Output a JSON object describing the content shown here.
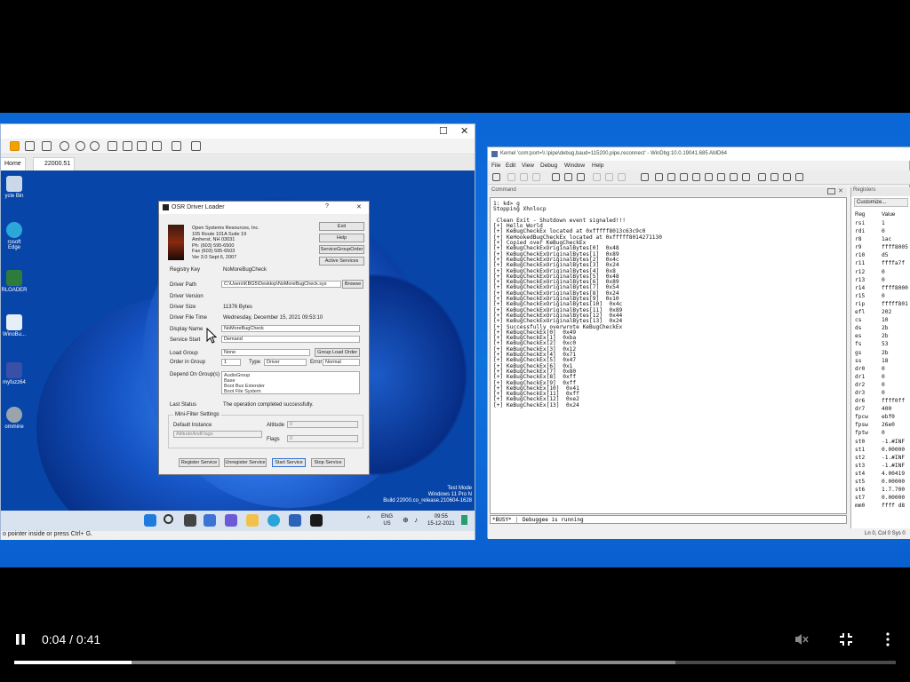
{
  "player": {
    "time": "0:04 / 0:41",
    "progress_fraction": 0.133,
    "buffered_fraction": 0.75
  },
  "vm": {
    "tab_home": "Home",
    "tab_machine": "22000.51",
    "status": "o pointer inside or press Ctrl+ G.",
    "desktop_icons": [
      "ycle Bin",
      "rosoft Edge",
      "RLOADER",
      "WinoBu...",
      "myfuzz64",
      "ommine"
    ],
    "watermark": [
      "Test Mode",
      "Windows 11 Pro N",
      "Build 22000.co_release.210604-1628"
    ],
    "tray": {
      "lang": "ENG",
      "region": "US",
      "time": "09:55",
      "date": "15-12-2021"
    }
  },
  "osr": {
    "title": "OSR Driver Loader",
    "company": [
      "Open Systems Resources, Inc.",
      "105 Route 101A Suite 19",
      "Amherst, NH 03031",
      "Ph: (603) 595-6500",
      "Fax (603) 595-6503",
      "Ver 3.0    Sept 6, 2007"
    ],
    "exit": "Exit",
    "help": "Help",
    "service_group": "ServiceGroupOrder",
    "active_services": "Active Services",
    "registry_key_label": "Registry Key",
    "registry_key": "NoMoreBugCheck",
    "driver_path_label": "Driver Path",
    "driver_path": "C:\\Users\\KBG5\\Desktop\\NoMoreBugCheck.sys",
    "browse": "Browse",
    "driver_version_label": "Driver Version",
    "driver_size_label": "Driver Size",
    "driver_size": "11376 Bytes",
    "driver_time_label": "Driver File Time",
    "driver_time": "Wednesday, December 15, 2021 09:53:10",
    "display_name_label": "Display Name",
    "display_name": "NoMoreBugCheck",
    "service_start_label": "Service Start",
    "service_start": "Demand",
    "load_group_label": "Load Group",
    "load_group": "None",
    "group_load_order": "Group Load Order",
    "order_group_label": "Order in Group",
    "order_group": "1",
    "type_label": "Type",
    "type_value": "Driver",
    "error_label": "Error",
    "error_value": "Normal",
    "depend_label": "Depend On Group(s)",
    "depend_items": [
      "AudioGroup",
      "Base",
      "Boot Bus Extender",
      "Boot File System"
    ],
    "last_status_label": "Last Status",
    "last_status": "The operation completed successfully.",
    "minifilter_label": "Mini-Filter Settings",
    "default_instance_label": "Default Instance",
    "default_instance": "AltitudeAndFlags",
    "altitude_label": "Altitude",
    "altitude": "0",
    "flags_label": "Flags",
    "flags": "0",
    "register": "Register Service",
    "unregister": "Unregister Service",
    "start": "Start Service",
    "stop": "Stop Service"
  },
  "windbg": {
    "title": "Kernel 'com:port=\\\\.\\pipe\\debug,baud=115200,pipe,reconnect' - WinDbg:10.0.19041.685 AMD64",
    "menu": [
      "File",
      "Edit",
      "View",
      "Debug",
      "Window",
      "Help"
    ],
    "command_header": "Command",
    "output": [
      "1: kd> g",
      "Stopping Xhnlocp",
      "",
      " Clean Exit - Shutdown event signaled!!!",
      "[+] Hello World",
      "[+] KeBugCheckEx located at 0xfffff8013c63c9c0",
      "[+] KeHookedBugCheckEx located at 0xfffff8014271130",
      "[+] Copied over KeBugCheckEx",
      "[+] KeBugCheckExOriginalBytes[0]  0x48",
      "[+] KeBugCheckExOriginalBytes[1]  0x89",
      "[+] KeBugCheckExOriginalBytes[2]  0x4c",
      "[+] KeBugCheckExOriginalBytes[3]  0x24",
      "[+] KeBugCheckExOriginalBytes[4]  0x8",
      "[+] KeBugCheckExOriginalBytes[5]  0x48",
      "[+] KeBugCheckExOriginalBytes[6]  0x89",
      "[+] KeBugCheckExOriginalBytes[7]  0x54",
      "[+] KeBugCheckExOriginalBytes[8]  0x24",
      "[+] KeBugCheckExOriginalBytes[9]  0x10",
      "[+] KeBugCheckExOriginalBytes[10]  0x4c",
      "[+] KeBugCheckExOriginalBytes[11]  0x89",
      "[+] KeBugCheckExOriginalBytes[12]  0x44",
      "[+] KeBugCheckExOriginalBytes[13]  0x24",
      "[+] Successfully overwrote KeBugCheckEx",
      "[+] KeBugCheckEx[0]  0x49",
      "[+] KeBugCheckEx[1]  0xba",
      "[+] KeBugCheckEx[2]  0xc0",
      "[+] KeBugCheckEx[3]  0x12",
      "[+] KeBugCheckEx[4]  0x71",
      "[+] KeBugCheckEx[5]  0x47",
      "[+] KeBugCheckEx[6]  0x1",
      "[+] KeBugCheckEx[7]  0x80",
      "[+] KeBugCheckEx[8]  0xff",
      "[+] KeBugCheckEx[9]  0xff",
      "[+] KeBugCheckEx[10]  0x41",
      "[+] KeBugCheckEx[11]  0xff",
      "[+] KeBugCheckEx[12]  0xe2",
      "[+] KeBugCheckEx[13]  0x24"
    ],
    "cmd_prefix": "*BUSY*",
    "cmd_text": "Debuggee is running",
    "registers_header": "Registers",
    "customize": "Customize...",
    "reg_col": "Reg",
    "val_col": "Value",
    "registers": [
      [
        "rsi",
        "1"
      ],
      [
        "rdi",
        "0"
      ],
      [
        "r8",
        "1ac"
      ],
      [
        "r9",
        "ffff8005"
      ],
      [
        "r10",
        "d5"
      ],
      [
        "r11",
        "ffffa7f"
      ],
      [
        "r12",
        "0"
      ],
      [
        "r13",
        "0"
      ],
      [
        "r14",
        "ffff8000"
      ],
      [
        "r15",
        "0"
      ],
      [
        "rip",
        "fffff801"
      ],
      [
        "efl",
        "202"
      ],
      [
        "cs",
        "10"
      ],
      [
        "ds",
        "2b"
      ],
      [
        "es",
        "2b"
      ],
      [
        "fs",
        "53"
      ],
      [
        "gs",
        "2b"
      ],
      [
        "ss",
        "18"
      ],
      [
        "dr0",
        "0"
      ],
      [
        "dr1",
        "0"
      ],
      [
        "dr2",
        "0"
      ],
      [
        "dr3",
        "0"
      ],
      [
        "dr6",
        "ffff0ff"
      ],
      [
        "dr7",
        "400"
      ],
      [
        "fpcw",
        "ebf0"
      ],
      [
        "fpsw",
        "26e0"
      ],
      [
        "fptw",
        "0"
      ],
      [
        "st0",
        "-1.#INF"
      ],
      [
        "st1",
        "0.00000"
      ],
      [
        "st2",
        "-1.#INF"
      ],
      [
        "st3",
        "-1.#INF"
      ],
      [
        "st4",
        "4.00419"
      ],
      [
        "st5",
        "0.00000"
      ],
      [
        "st6",
        "1.7.700"
      ],
      [
        "st7",
        "0.00000"
      ],
      [
        "mm0",
        "ffff d8"
      ]
    ],
    "status": "Ln 0, Col 0   Sys 0"
  },
  "colors": {
    "wallpaper": "#0b66d6",
    "bloom_dark": "#06318a",
    "bloom_light": "#3a8cf0"
  }
}
